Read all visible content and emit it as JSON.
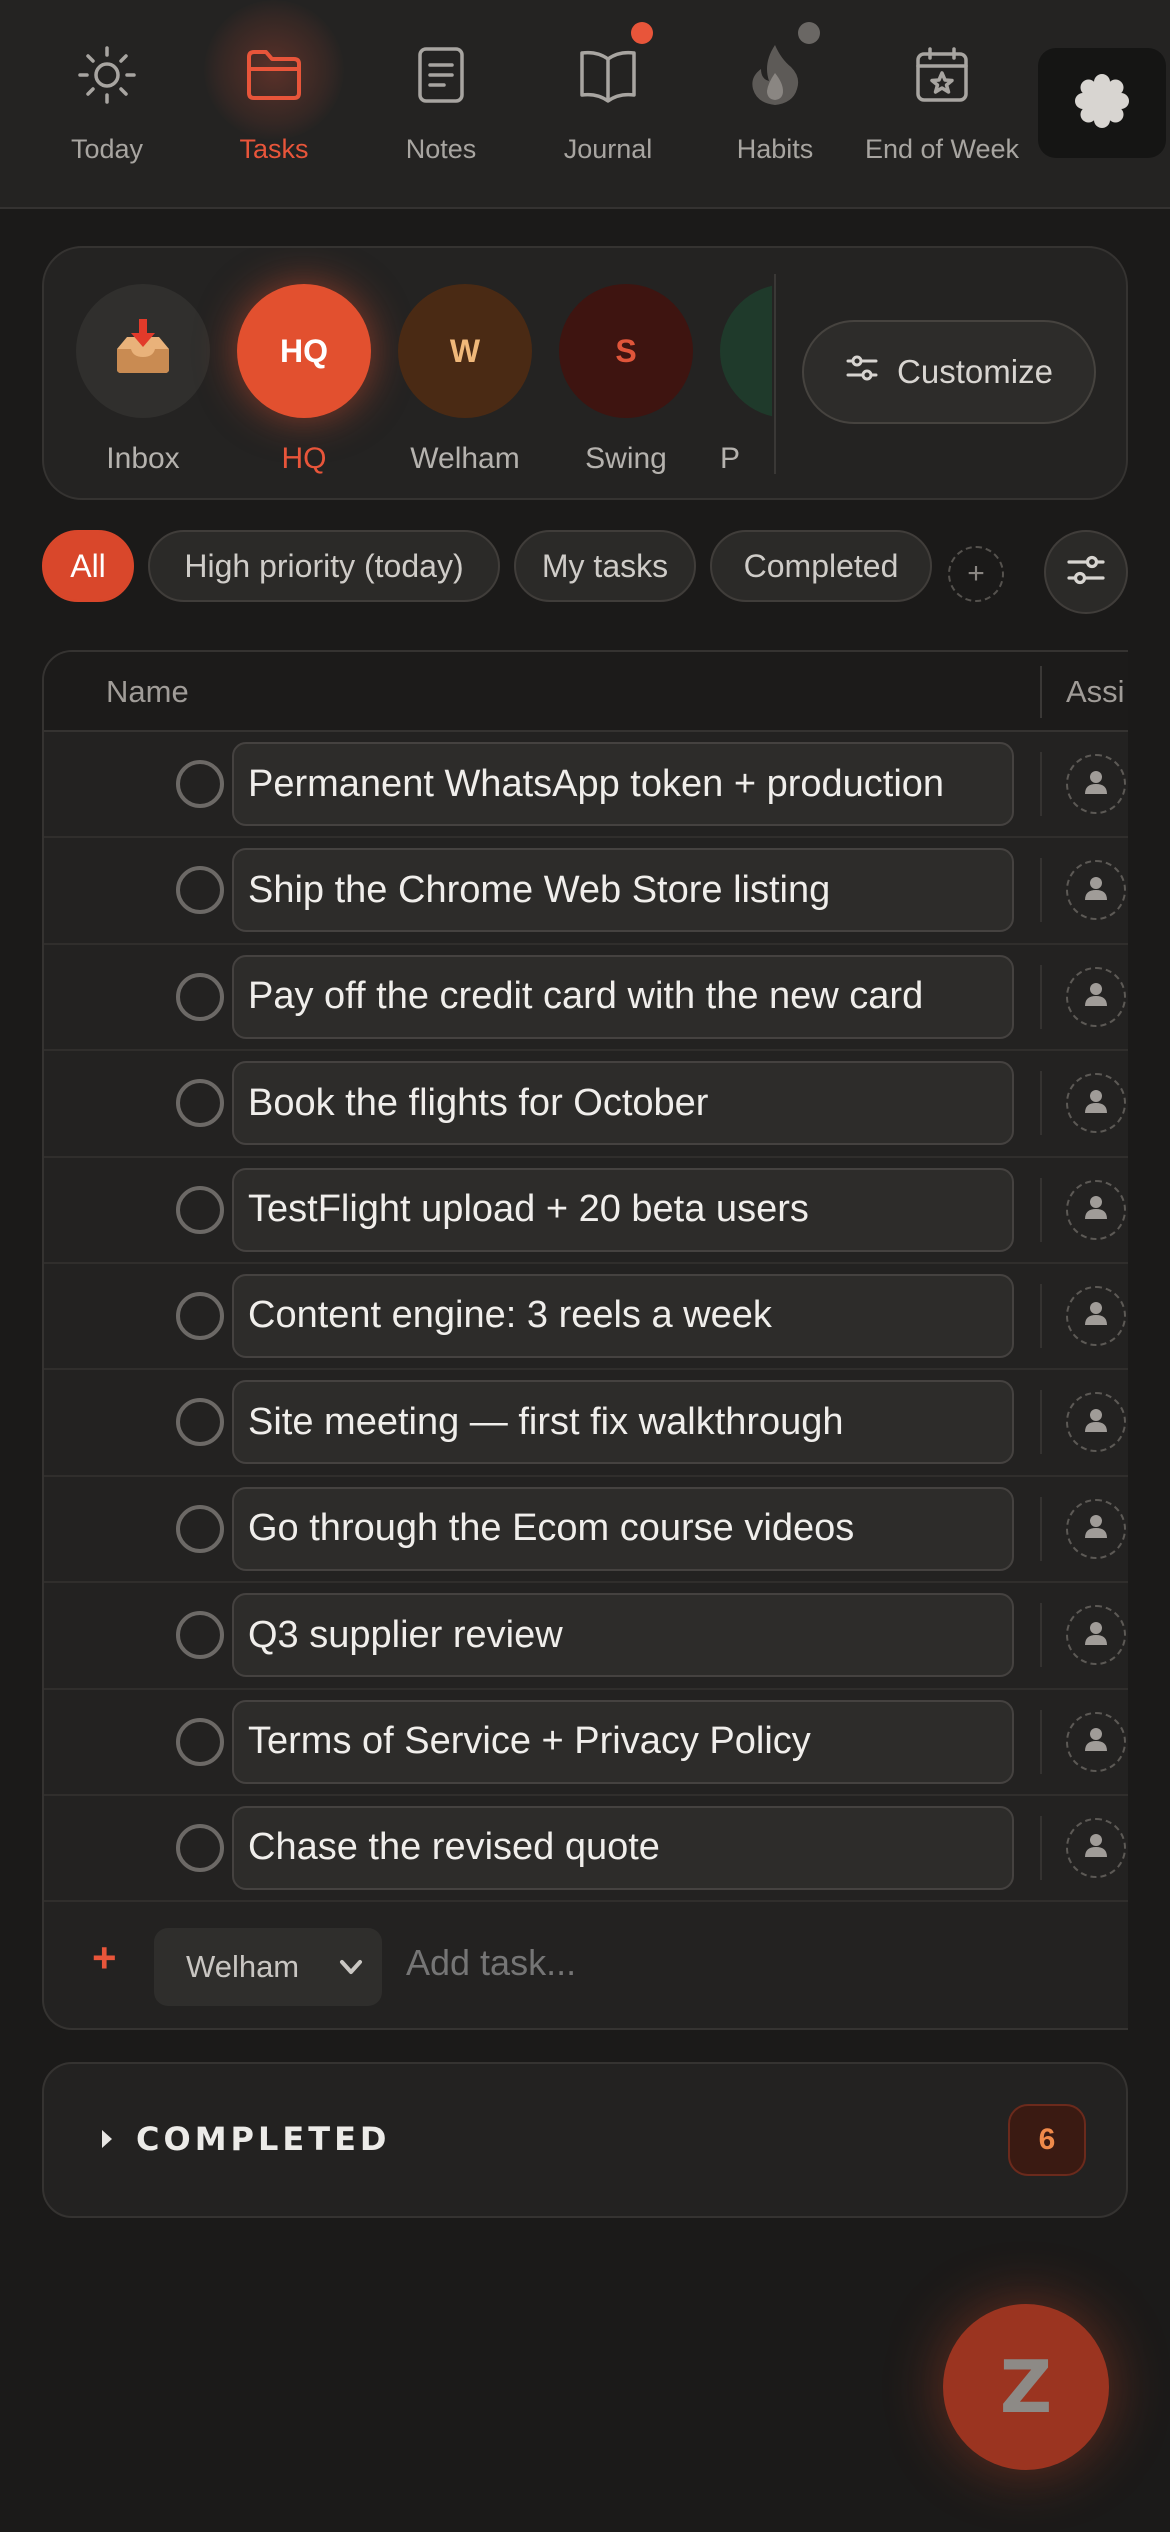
{
  "nav": {
    "items": [
      {
        "label": "Today",
        "icon": "sun-icon"
      },
      {
        "label": "Tasks",
        "icon": "folder-icon",
        "active": true
      },
      {
        "label": "Notes",
        "icon": "note-icon"
      },
      {
        "label": "Journal",
        "icon": "book-icon"
      },
      {
        "label": "Habits",
        "icon": "flame-icon"
      },
      {
        "label": "End of Week",
        "icon": "calendar-star-icon"
      }
    ],
    "settings_icon": "gear-icon"
  },
  "projects": {
    "items": [
      {
        "label": "Inbox",
        "initials": ""
      },
      {
        "label": "HQ",
        "initials": "HQ",
        "active": true
      },
      {
        "label": "Welham",
        "initials": "W"
      },
      {
        "label": "Swing",
        "initials": "S"
      },
      {
        "label": "P",
        "initials": ""
      }
    ],
    "customize_label": "Customize"
  },
  "filters": {
    "items": [
      "All",
      "High priority (today)",
      "My tasks",
      "Completed"
    ],
    "add_label": "+"
  },
  "table": {
    "col_name": "Name",
    "col_assignee": "Assi",
    "tasks": [
      "Permanent WhatsApp token + production",
      "Ship the Chrome Web Store listing",
      "Pay off the credit card with the new card",
      "Book the flights for October",
      "TestFlight upload + 20 beta users",
      "Content engine: 3 reels a week",
      "Site meeting — first fix walkthrough",
      "Go through the Ecom course videos",
      "Q3 supplier review",
      "Terms of Service + Privacy Policy",
      "Chase the revised quote"
    ],
    "add_plus": "+",
    "add_project": "Welham",
    "add_placeholder": "Add task..."
  },
  "completed": {
    "label": "COMPLETED",
    "count": "6"
  },
  "fab": {
    "label": "Z"
  },
  "colors": {
    "accent": "#e8553a",
    "background": "#1b1a19",
    "surface": "#242322"
  }
}
